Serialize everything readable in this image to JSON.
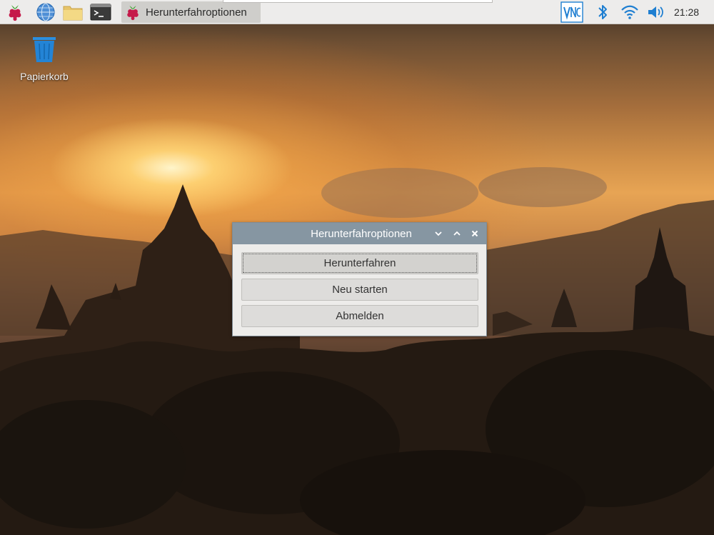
{
  "taskbar": {
    "launchers": [
      {
        "name": "raspberry-menu",
        "icon": "raspberry-icon"
      },
      {
        "name": "web-browser",
        "icon": "globe-icon"
      },
      {
        "name": "file-manager",
        "icon": "folder-icon"
      },
      {
        "name": "terminal",
        "icon": "terminal-icon"
      }
    ],
    "active_task": {
      "label": "Herunterfahroptionen",
      "icon": "raspberry-icon"
    },
    "tray": {
      "vnc_icon": "vnc-icon",
      "bluetooth_icon": "bluetooth-icon",
      "wifi_icon": "wifi-icon",
      "volume_icon": "volume-icon",
      "clock": "21:28"
    }
  },
  "desktop": {
    "trash": {
      "label": "Papierkorb",
      "icon": "trash-icon"
    }
  },
  "dialog": {
    "title": "Herunterfahroptionen",
    "controls": [
      "minimize-icon",
      "maximize-icon",
      "close-icon"
    ],
    "buttons": {
      "shutdown": "Herunterfahren",
      "reboot": "Neu starten",
      "logout": "Abmelden"
    }
  },
  "colors": {
    "panel": "#edeceb",
    "titlebar": "#8696a2",
    "accent_blue": "#1f7fd1",
    "raspberry_red": "#c51a4a"
  }
}
